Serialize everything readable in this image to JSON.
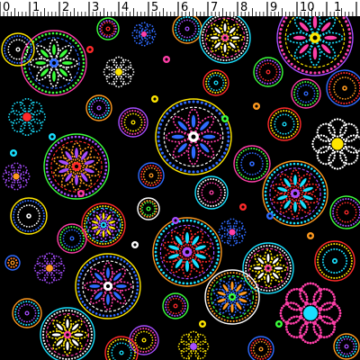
{
  "ruler": {
    "labels": [
      "0",
      "1",
      "2",
      "3",
      "4",
      "5",
      "6",
      "7",
      "8",
      "9",
      "10",
      "1"
    ]
  },
  "palette": {
    "background": "#000000",
    "ruler": "#ffffff",
    "accents": [
      "#ff2a2a",
      "#ff3fa8",
      "#ff9a1f",
      "#ffe600",
      "#3cff3c",
      "#19e0ff",
      "#2f6bff",
      "#a64dff",
      "#ffffff"
    ]
  }
}
